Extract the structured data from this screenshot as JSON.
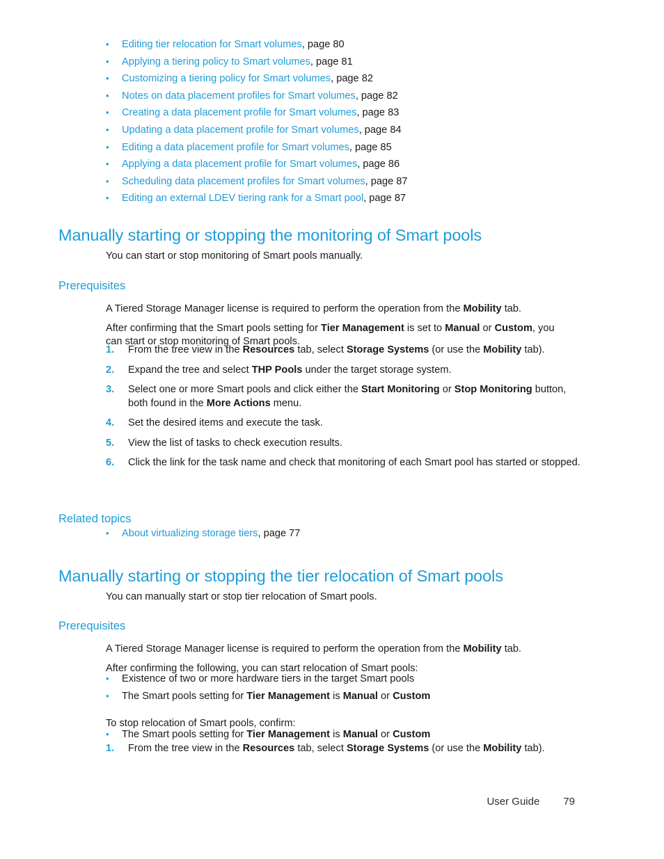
{
  "document": {
    "type": "user-guide-page"
  },
  "xref_list": {
    "bullet": "•",
    "items": [
      {
        "link": "Editing tier relocation for Smart volumes",
        "page": ", page 80"
      },
      {
        "link": "Applying a tiering policy to Smart volumes",
        "page": ", page 81"
      },
      {
        "link": "Customizing a tiering policy for Smart volumes",
        "page": ", page 82"
      },
      {
        "link": "Notes on data placement profiles for Smart volumes",
        "page": ", page 82"
      },
      {
        "link": "Creating a data placement profile for Smart volumes",
        "page": ", page 83"
      },
      {
        "link": "Updating a data placement profile for Smart volumes",
        "page": ", page 84"
      },
      {
        "link": "Editing a data placement profile for Smart volumes",
        "page": ", page 85"
      },
      {
        "link": "Applying a data placement profile for Smart volumes",
        "page": ", page 86"
      },
      {
        "link": "Scheduling data placement profiles for Smart volumes",
        "page": ", page 87"
      },
      {
        "link": "Editing an external LDEV tiering rank for a Smart pool",
        "page": ", page 87"
      }
    ]
  },
  "section_monitoring": {
    "heading": "Manually starting or stopping the monitoring of Smart pools",
    "intro": "You can start or stop monitoring of Smart pools manually.",
    "prerequisites_heading": "Prerequisites",
    "prereq_paragraph_1": "A Tiered Storage Manager license is required to perform the operation from the Mobility tab.",
    "prereq_paragraph_2": "After confirming that the Smart pools setting for Tier Management is set to Manual or Custom, you can start or stop monitoring of Smart pools.",
    "steps": [
      {
        "num": "1.",
        "text": "From the tree view in the Resources tab, select Storage Systems (or use the Mobility tab)."
      },
      {
        "num": "2.",
        "text": "Expand the tree and select THP Pools under the target storage system."
      },
      {
        "num": "3.",
        "text": "Select one or more Smart pools and click either the Start Monitoring or Stop Monitoring button, both found in the More Actions menu."
      },
      {
        "num": "4.",
        "text": "Set the desired items and execute the task."
      },
      {
        "num": "5.",
        "text": "View the list of tasks to check execution results."
      },
      {
        "num": "6.",
        "text": "Click the link for the task name and check that monitoring of each Smart pool has started or stopped."
      }
    ],
    "related_topics_heading": "Related topics",
    "related_topics": [
      {
        "link": "About virtualizing storage tiers",
        "page": ", page 77"
      }
    ]
  },
  "section_relocation": {
    "heading": "Manually starting or stopping the tier relocation of Smart pools",
    "intro": "You can manually start or stop tier relocation of Smart pools.",
    "prerequisites_heading": "Prerequisites",
    "prereq_paragraph_1": "A Tiered Storage Manager license is required to perform the operation from the Mobility tab.",
    "prereq_paragraph_2": "After confirming the following, you can start relocation of Smart pools:",
    "start_conditions": [
      "Existence of two or more hardware tiers in the target Smart pools",
      "The Smart pools setting for Tier Management is Manual or Custom"
    ],
    "stop_intro": "To stop relocation of Smart pools, confirm:",
    "stop_conditions": [
      "The Smart pools setting for Tier Management is Manual or Custom"
    ],
    "steps": [
      {
        "num": "1.",
        "text": "From the tree view in the Resources tab, select Storage Systems (or use the Mobility tab)."
      }
    ]
  },
  "footer": {
    "label": "User Guide",
    "page_number": "79"
  },
  "colors": {
    "link": "#1f9cd7",
    "heading": "#1f9cd7",
    "body_text": "#1a1a1a",
    "background": "#ffffff"
  }
}
